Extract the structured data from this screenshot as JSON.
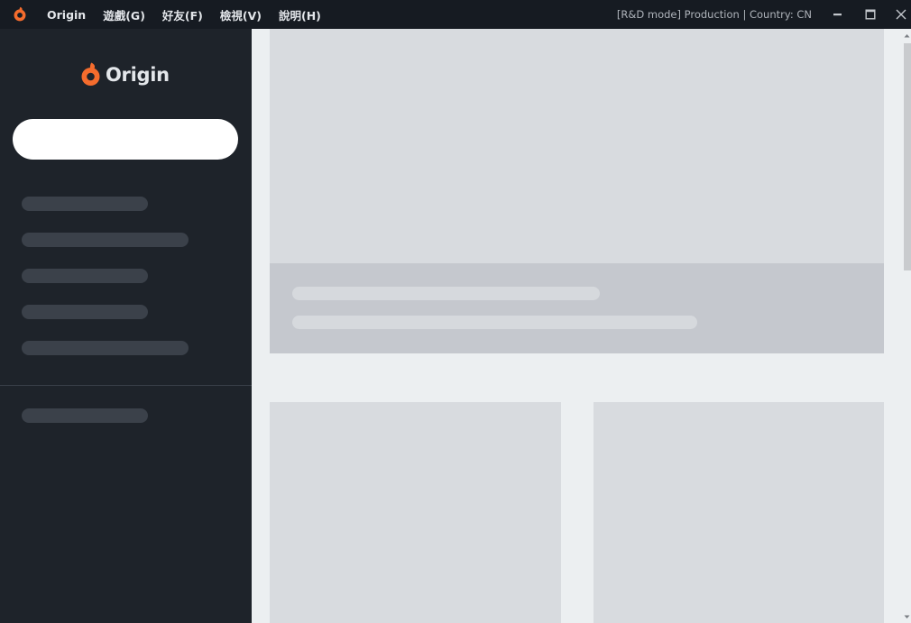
{
  "titlebar": {
    "menu": [
      "Origin",
      "遊戲(G)",
      "好友(F)",
      "檢視(V)",
      "說明(H)"
    ],
    "status": "[R&D mode] Production | Country: CN"
  },
  "sidebar": {
    "brand": "Origin",
    "search_value": ""
  },
  "colors": {
    "brand_orange": "#f56c2d",
    "titlebar_bg": "#161b22",
    "sidebar_bg": "#1e232a",
    "content_bg": "#eceff1",
    "skeleton_light": "#d8dbdf",
    "skeleton_dark": "#c5c8ce"
  },
  "icons": [
    "origin-logo-icon",
    "minimize-icon",
    "maximize-icon",
    "close-icon",
    "scroll-up-arrow-icon",
    "scroll-down-arrow-icon"
  ]
}
